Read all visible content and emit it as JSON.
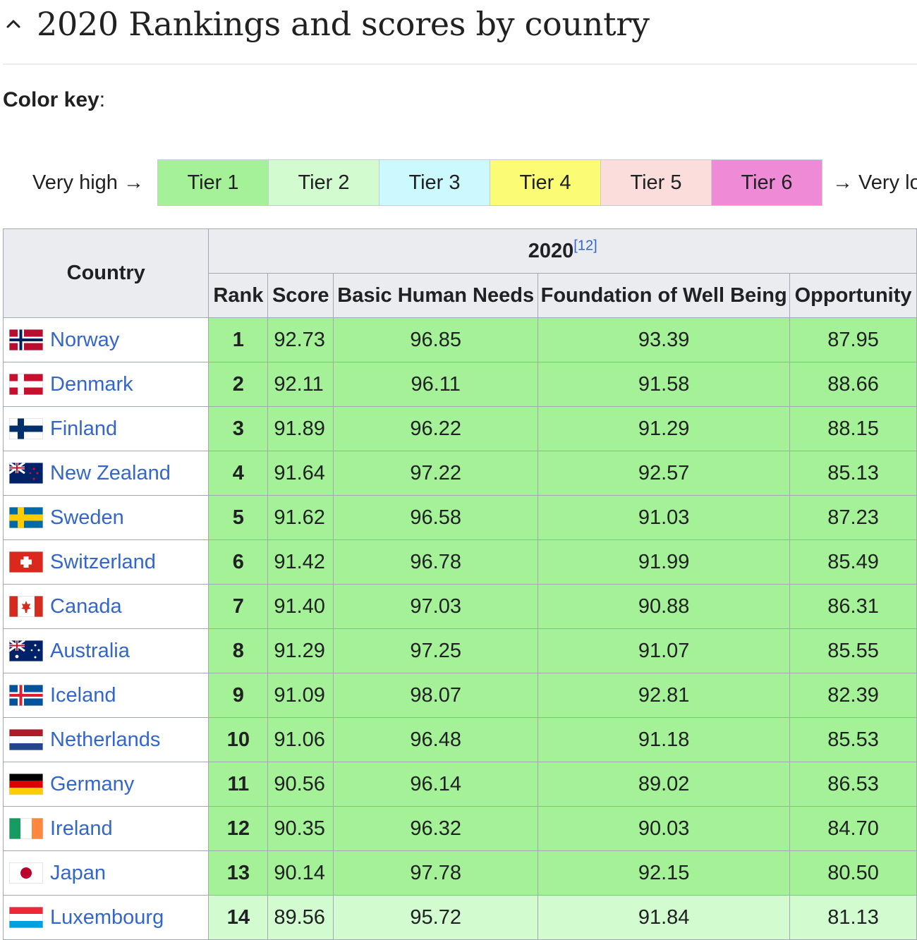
{
  "section": {
    "title": "2020 Rankings and scores by country",
    "collapse_icon": "chevron-up-icon"
  },
  "color_key": {
    "label": "Color key",
    "colon": ":",
    "start": "Very high →",
    "end": "→ Very lo",
    "tiers": [
      {
        "label": "Tier 1",
        "color": "#a4f198"
      },
      {
        "label": "Tier 2",
        "color": "#d2fbd0"
      },
      {
        "label": "Tier 3",
        "color": "#ccf9fe"
      },
      {
        "label": "Tier 4",
        "color": "#fbfc74"
      },
      {
        "label": "Tier 5",
        "color": "#fbdddb"
      },
      {
        "label": "Tier 6",
        "color": "#ee8ad6"
      }
    ]
  },
  "table": {
    "country_header": "Country",
    "year_header": "2020",
    "year_ref": "[12]",
    "columns": [
      "Rank",
      "Score",
      "Basic Human Needs",
      "Foundation of Well Being",
      "Opportunity"
    ],
    "rows": [
      {
        "country": "Norway",
        "flag": "norway-flag-icon",
        "rank": "1",
        "score": "92.73",
        "bhn": "96.85",
        "fwb": "93.39",
        "opp": "87.95",
        "tier_color": "#a4f198"
      },
      {
        "country": "Denmark",
        "flag": "denmark-flag-icon",
        "rank": "2",
        "score": "92.11",
        "bhn": "96.11",
        "fwb": "91.58",
        "opp": "88.66",
        "tier_color": "#a4f198"
      },
      {
        "country": "Finland",
        "flag": "finland-flag-icon",
        "rank": "3",
        "score": "91.89",
        "bhn": "96.22",
        "fwb": "91.29",
        "opp": "88.15",
        "tier_color": "#a4f198"
      },
      {
        "country": "New Zealand",
        "flag": "new-zealand-flag-icon",
        "rank": "4",
        "score": "91.64",
        "bhn": "97.22",
        "fwb": "92.57",
        "opp": "85.13",
        "tier_color": "#a4f198"
      },
      {
        "country": "Sweden",
        "flag": "sweden-flag-icon",
        "rank": "5",
        "score": "91.62",
        "bhn": "96.58",
        "fwb": "91.03",
        "opp": "87.23",
        "tier_color": "#a4f198"
      },
      {
        "country": "Switzerland",
        "flag": "switzerland-flag-icon",
        "rank": "6",
        "score": "91.42",
        "bhn": "96.78",
        "fwb": "91.99",
        "opp": "85.49",
        "tier_color": "#a4f198"
      },
      {
        "country": "Canada",
        "flag": "canada-flag-icon",
        "rank": "7",
        "score": "91.40",
        "bhn": "97.03",
        "fwb": "90.88",
        "opp": "86.31",
        "tier_color": "#a4f198"
      },
      {
        "country": "Australia",
        "flag": "australia-flag-icon",
        "rank": "8",
        "score": "91.29",
        "bhn": "97.25",
        "fwb": "91.07",
        "opp": "85.55",
        "tier_color": "#a4f198"
      },
      {
        "country": "Iceland",
        "flag": "iceland-flag-icon",
        "rank": "9",
        "score": "91.09",
        "bhn": "98.07",
        "fwb": "92.81",
        "opp": "82.39",
        "tier_color": "#a4f198"
      },
      {
        "country": "Netherlands",
        "flag": "netherlands-flag-icon",
        "rank": "10",
        "score": "91.06",
        "bhn": "96.48",
        "fwb": "91.18",
        "opp": "85.53",
        "tier_color": "#a4f198"
      },
      {
        "country": "Germany",
        "flag": "germany-flag-icon",
        "rank": "11",
        "score": "90.56",
        "bhn": "96.14",
        "fwb": "89.02",
        "opp": "86.53",
        "tier_color": "#a4f198"
      },
      {
        "country": "Ireland",
        "flag": "ireland-flag-icon",
        "rank": "12",
        "score": "90.35",
        "bhn": "96.32",
        "fwb": "90.03",
        "opp": "84.70",
        "tier_color": "#a4f198"
      },
      {
        "country": "Japan",
        "flag": "japan-flag-icon",
        "rank": "13",
        "score": "90.14",
        "bhn": "97.78",
        "fwb": "92.15",
        "opp": "80.50",
        "tier_color": "#a4f198"
      },
      {
        "country": "Luxembourg",
        "flag": "luxembourg-flag-icon",
        "rank": "14",
        "score": "89.56",
        "bhn": "95.72",
        "fwb": "91.84",
        "opp": "81.13",
        "tier_color": "#d2fbd0"
      }
    ]
  }
}
